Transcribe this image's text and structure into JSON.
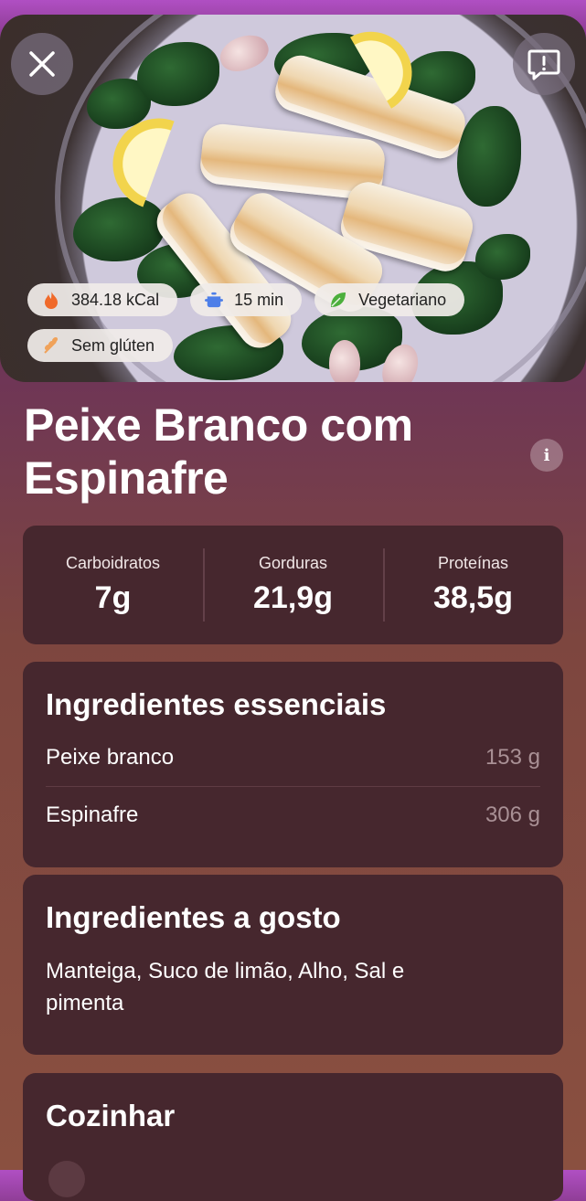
{
  "hero": {
    "image_alt": "Peixe branco grelhado sobre espinafre com limão e alho",
    "tags_row1": [
      {
        "icon": "flame-icon",
        "label": "384.18 kCal",
        "color": "#f06a2a"
      },
      {
        "icon": "pot-icon",
        "label": "15 min",
        "color": "#4d7ee8"
      },
      {
        "icon": "leaf-icon",
        "label": "Vegetariano",
        "color": "#4caf3c"
      }
    ],
    "tags_row2": [
      {
        "icon": "wheat-icon",
        "label": "Sem glúten",
        "color": "#f0a25a"
      }
    ]
  },
  "recipe": {
    "title": "Peixe Branco com Espinafre"
  },
  "macros": [
    {
      "label": "Carboidratos",
      "value": "7g"
    },
    {
      "label": "Gorduras",
      "value": "21,9g"
    },
    {
      "label": "Proteínas",
      "value": "38,5g"
    }
  ],
  "essentials": {
    "title": "Ingredientes essenciais",
    "items": [
      {
        "name": "Peixe branco",
        "qty": "153 g"
      },
      {
        "name": "Espinafre",
        "qty": "306 g"
      }
    ]
  },
  "taste": {
    "title": "Ingredientes a gosto",
    "text": "Manteiga, Suco de limão, Alho, Sal e pimenta"
  },
  "cook": {
    "title": "Cozinhar"
  }
}
